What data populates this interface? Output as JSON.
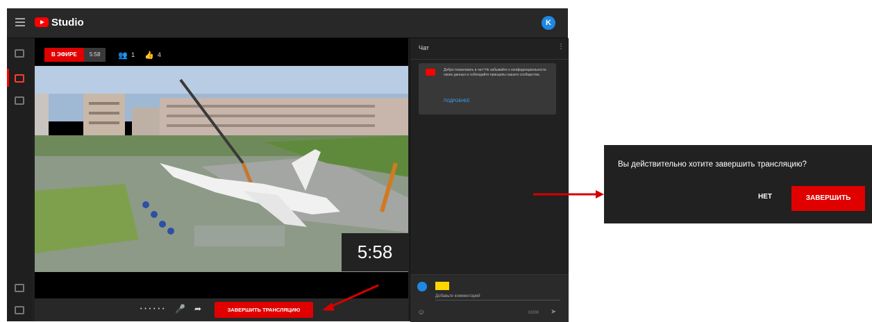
{
  "app": {
    "brand": "Studio",
    "account_initial": "K"
  },
  "stream": {
    "live_label": "В ЭФИРЕ",
    "duration": "5:58",
    "viewers": "1",
    "likes": "4",
    "timer": "5:58",
    "end_stream_label": "ЗАВЕРШИТЬ ТРАНСЛЯЦИЮ"
  },
  "chat": {
    "title": "Чат",
    "welcome_text": "Добро пожаловать в чат! Не забывайте о конфиденциальности своих данных и соблюдайте принципы нашего сообщества.",
    "welcome_link": "ПОДРОБНЕЕ",
    "input_placeholder": "Добавьте комментарий",
    "char_counter": "0/200"
  },
  "dialog": {
    "question": "Вы действительно хотите завершить трансляцию?",
    "no_label": "НЕТ",
    "confirm_label": "ЗАВЕРШИТЬ"
  },
  "icons": {
    "menu": "menu-icon",
    "logo": "youtube-logo-icon",
    "viewers": "viewers-icon",
    "likes": "thumb-up-icon",
    "mic": "mic-icon",
    "share": "share-icon",
    "emoji": "emoji-icon",
    "send": "send-icon"
  },
  "colors": {
    "accent_red": "#e00000",
    "background_dark": "#212121",
    "link_blue": "#3ea6ff"
  }
}
